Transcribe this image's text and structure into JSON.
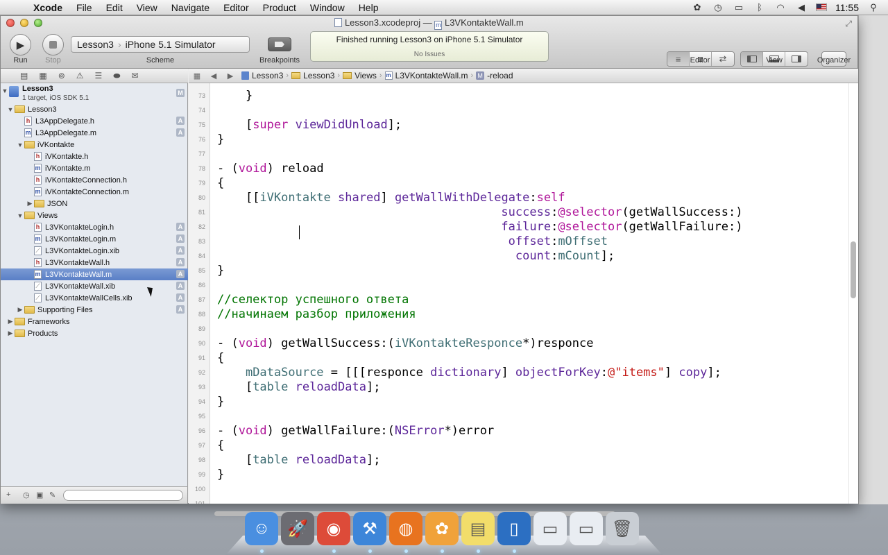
{
  "menubar": {
    "app_name": "Xcode",
    "items": [
      "File",
      "Edit",
      "View",
      "Navigate",
      "Editor",
      "Product",
      "Window",
      "Help"
    ],
    "clock": "11:55"
  },
  "window": {
    "title": "Lesson3.xcodeproj",
    "separator": "—",
    "file_name": "L3VKontakteWall.m"
  },
  "toolbar": {
    "run_label": "Run",
    "stop_label": "Stop",
    "scheme": {
      "target": "Lesson3",
      "destination": "iPhone 5.1 Simulator",
      "label": "Scheme"
    },
    "breakpoints_label": "Breakpoints",
    "activity": {
      "status": "Finished running Lesson3 on iPhone 5.1 Simulator",
      "issues": "No Issues"
    },
    "editor_label": "Editor",
    "view_label": "View",
    "organizer_label": "Organizer"
  },
  "navigator": {
    "project": {
      "name": "Lesson3",
      "subtitle": "1 target, iOS SDK 5.1"
    },
    "rows": [
      {
        "label": "Lesson3",
        "kind": "folder",
        "indent": 1,
        "disclosure": "open"
      },
      {
        "label": "L3AppDelegate.h",
        "kind": "h",
        "indent": 2,
        "badge": "A"
      },
      {
        "label": "L3AppDelegate.m",
        "kind": "m",
        "indent": 2,
        "badge": "A"
      },
      {
        "label": "iVKontakte",
        "kind": "folder",
        "indent": 2,
        "disclosure": "open"
      },
      {
        "label": "iVKontakte.h",
        "kind": "h",
        "indent": 3
      },
      {
        "label": "iVKontakte.m",
        "kind": "m",
        "indent": 3
      },
      {
        "label": "iVKontakteConnection.h",
        "kind": "h",
        "indent": 3
      },
      {
        "label": "iVKontakteConnection.m",
        "kind": "m",
        "indent": 3
      },
      {
        "label": "JSON",
        "kind": "folder",
        "indent": 3,
        "disclosure": "closed"
      },
      {
        "label": "Views",
        "kind": "folder",
        "indent": 2,
        "disclosure": "open"
      },
      {
        "label": "L3VKontakteLogin.h",
        "kind": "h",
        "indent": 3,
        "badge": "A"
      },
      {
        "label": "L3VKontakteLogin.m",
        "kind": "m",
        "indent": 3,
        "badge": "A"
      },
      {
        "label": "L3VKontakteLogin.xib",
        "kind": "xib",
        "indent": 3,
        "badge": "A"
      },
      {
        "label": "L3VKontakteWall.h",
        "kind": "h",
        "indent": 3,
        "badge": "A"
      },
      {
        "label": "L3VKontakteWall.m",
        "kind": "m",
        "indent": 3,
        "badge": "A",
        "selected": true
      },
      {
        "label": "L3VKontakteWall.xib",
        "kind": "xib",
        "indent": 3,
        "badge": "A"
      },
      {
        "label": "L3VKontakteWallCells.xib",
        "kind": "xib",
        "indent": 3,
        "badge": "A"
      },
      {
        "label": "Supporting Files",
        "kind": "folder",
        "indent": 2,
        "disclosure": "closed",
        "badge": "A"
      },
      {
        "label": "Frameworks",
        "kind": "folder",
        "indent": 1,
        "disclosure": "closed"
      },
      {
        "label": "Products",
        "kind": "folder",
        "indent": 1,
        "disclosure": "closed"
      }
    ]
  },
  "jumpbar": {
    "crumbs": [
      "Lesson3",
      "Lesson3",
      "Views",
      "L3VKontakteWall.m",
      "-reload"
    ]
  },
  "editor": {
    "lines": [
      {
        "n": "73",
        "tokens": [
          [
            "p",
            "    }"
          ]
        ]
      },
      {
        "n": "74",
        "tokens": []
      },
      {
        "n": "75",
        "tokens": [
          [
            "p",
            "    ["
          ],
          [
            "kw",
            "super"
          ],
          [
            "p",
            " "
          ],
          [
            "cls",
            "viewDidUnload"
          ],
          [
            "p",
            "];"
          ]
        ]
      },
      {
        "n": "76",
        "tokens": [
          [
            "p",
            "}"
          ]
        ]
      },
      {
        "n": "77",
        "tokens": []
      },
      {
        "n": "78",
        "tokens": [
          [
            "p",
            "- ("
          ],
          [
            "kw",
            "void"
          ],
          [
            "p",
            ") reload"
          ]
        ]
      },
      {
        "n": "79",
        "tokens": [
          [
            "p",
            "{"
          ]
        ]
      },
      {
        "n": "80",
        "tokens": [
          [
            "p",
            "    [["
          ],
          [
            "proj",
            "iVKontakte"
          ],
          [
            "p",
            " "
          ],
          [
            "cls",
            "shared"
          ],
          [
            "p",
            "] "
          ],
          [
            "cls",
            "getWallWithDelegate"
          ],
          [
            "p",
            ":"
          ],
          [
            "kw",
            "self"
          ]
        ]
      },
      {
        "n": "81",
        "tokens": [
          [
            "p",
            "                                        "
          ],
          [
            "cls",
            "success"
          ],
          [
            "p",
            ":"
          ],
          [
            "kw",
            "@selector"
          ],
          [
            "p",
            "(getWallSuccess:)"
          ]
        ]
      },
      {
        "n": "82",
        "tokens": [
          [
            "p",
            "                                        "
          ],
          [
            "cls",
            "failure"
          ],
          [
            "p",
            ":"
          ],
          [
            "kw",
            "@selector"
          ],
          [
            "p",
            "(getWallFailure:)"
          ]
        ]
      },
      {
        "n": "83",
        "tokens": [
          [
            "p",
            "                                         "
          ],
          [
            "cls",
            "offset"
          ],
          [
            "p",
            ":"
          ],
          [
            "proj",
            "mOffset"
          ]
        ]
      },
      {
        "n": "84",
        "tokens": [
          [
            "p",
            "                                          "
          ],
          [
            "cls",
            "count"
          ],
          [
            "p",
            ":"
          ],
          [
            "proj",
            "mCount"
          ],
          [
            "p",
            "];"
          ]
        ]
      },
      {
        "n": "85",
        "tokens": [
          [
            "p",
            "}"
          ]
        ]
      },
      {
        "n": "86",
        "tokens": []
      },
      {
        "n": "87",
        "tokens": [
          [
            "cmt",
            "//селектор успешного ответа"
          ]
        ]
      },
      {
        "n": "88",
        "tokens": [
          [
            "cmt",
            "//начинаем разбор приложения"
          ]
        ]
      },
      {
        "n": "89",
        "tokens": []
      },
      {
        "n": "90",
        "tokens": [
          [
            "p",
            "- ("
          ],
          [
            "kw",
            "void"
          ],
          [
            "p",
            ") getWallSuccess:("
          ],
          [
            "proj",
            "iVKontakteResponce"
          ],
          [
            "p",
            "*)responce"
          ]
        ]
      },
      {
        "n": "91",
        "tokens": [
          [
            "p",
            "{"
          ]
        ]
      },
      {
        "n": "92",
        "tokens": [
          [
            "p",
            "    "
          ],
          [
            "proj",
            "mDataSource"
          ],
          [
            "p",
            " = [[[responce "
          ],
          [
            "cls",
            "dictionary"
          ],
          [
            "p",
            "] "
          ],
          [
            "cls",
            "objectForKey"
          ],
          [
            "p",
            ":"
          ],
          [
            "str",
            "@\"items\""
          ],
          [
            "p",
            "] "
          ],
          [
            "cls",
            "copy"
          ],
          [
            "p",
            "];"
          ]
        ]
      },
      {
        "n": "93",
        "tokens": [
          [
            "p",
            "    ["
          ],
          [
            "proj",
            "table"
          ],
          [
            "p",
            " "
          ],
          [
            "cls",
            "reloadData"
          ],
          [
            "p",
            "];"
          ]
        ]
      },
      {
        "n": "94",
        "tokens": [
          [
            "p",
            "}"
          ]
        ]
      },
      {
        "n": "95",
        "tokens": []
      },
      {
        "n": "96",
        "tokens": [
          [
            "p",
            "- ("
          ],
          [
            "kw",
            "void"
          ],
          [
            "p",
            ") getWallFailure:("
          ],
          [
            "cls",
            "NSError"
          ],
          [
            "p",
            "*)error"
          ]
        ]
      },
      {
        "n": "97",
        "tokens": [
          [
            "p",
            "{"
          ]
        ]
      },
      {
        "n": "98",
        "tokens": [
          [
            "p",
            "    ["
          ],
          [
            "proj",
            "table"
          ],
          [
            "p",
            " "
          ],
          [
            "cls",
            "reloadData"
          ],
          [
            "p",
            "];"
          ]
        ]
      },
      {
        "n": "99",
        "tokens": [
          [
            "p",
            "}"
          ]
        ]
      },
      {
        "n": "100",
        "tokens": []
      },
      {
        "n": "101",
        "tokens": []
      }
    ]
  },
  "colors": {
    "keyword": "#b0179a",
    "class": "#5c2699",
    "project_symbol": "#3f6e74",
    "string": "#c41a16",
    "comment": "#007400",
    "selection": "#5a7fc6"
  },
  "dock": {
    "apps": [
      {
        "icon": "finder-icon",
        "color": "#4a8fe0"
      },
      {
        "icon": "launchpad-icon",
        "color": "#6c6c72"
      },
      {
        "icon": "chrome-icon",
        "color": "#dd4b39"
      },
      {
        "icon": "xcode-icon",
        "color": "#3d86d9"
      },
      {
        "icon": "firefox-icon",
        "color": "#e8731f"
      },
      {
        "icon": "flower-app-icon",
        "color": "#f0a23a"
      },
      {
        "icon": "stickies-icon",
        "color": "#f2dd6a"
      },
      {
        "icon": "ios-simulator-icon",
        "color": "#2c6fc2"
      },
      {
        "icon": "minimized-window-icon",
        "color": "#e9edf2"
      },
      {
        "icon": "minimized-window-icon",
        "color": "#e9edf2"
      },
      {
        "icon": "trash-icon",
        "color": "#c9ced4"
      }
    ]
  }
}
